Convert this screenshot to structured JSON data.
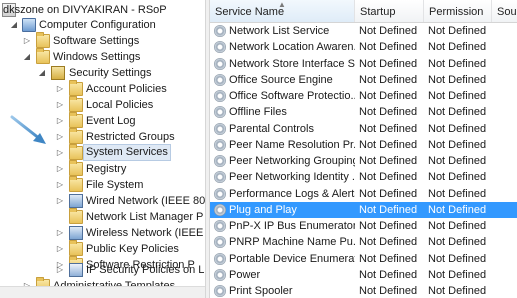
{
  "tree": {
    "items": [
      {
        "label": "dkszone on DIVYAKIRAN - RSoP",
        "icon": "rsop-icon",
        "expander": ""
      },
      {
        "label": "Computer Configuration",
        "icon": "computer-icon",
        "expander": "◢"
      },
      {
        "label": "Software Settings",
        "icon": "folder-icon",
        "expander": "▷"
      },
      {
        "label": "Windows Settings",
        "icon": "folder-icon",
        "expander": "◢"
      },
      {
        "label": "Security Settings",
        "icon": "security-settings-icon",
        "expander": "◢"
      },
      {
        "label": "Account Policies",
        "icon": "folder-icon",
        "expander": "▷"
      },
      {
        "label": "Local Policies",
        "icon": "folder-icon",
        "expander": "▷"
      },
      {
        "label": "Event Log",
        "icon": "folder-icon",
        "expander": "▷"
      },
      {
        "label": "Restricted Groups",
        "icon": "folder-icon",
        "expander": "▷"
      },
      {
        "label": "System Services",
        "icon": "folder-icon",
        "expander": "▷"
      },
      {
        "label": "Registry",
        "icon": "folder-icon",
        "expander": "▷"
      },
      {
        "label": "File System",
        "icon": "folder-icon",
        "expander": "▷"
      },
      {
        "label": "Wired Network (IEEE 80",
        "icon": "network-icon",
        "expander": "▷"
      },
      {
        "label": "Network List Manager P",
        "icon": "folder-icon",
        "expander": ""
      },
      {
        "label": "Wireless Network (IEEE",
        "icon": "network-icon",
        "expander": "▷"
      },
      {
        "label": "Public Key Policies",
        "icon": "folder-icon",
        "expander": "▷"
      },
      {
        "label": "Software Restriction P",
        "icon": "folder-icon",
        "expander": "▷"
      },
      {
        "label": "IP Security Policies on L",
        "icon": "ip-security-icon",
        "expander": "▷"
      },
      {
        "label": "Administrative Templates",
        "icon": "folder-icon",
        "expander": "▷"
      }
    ]
  },
  "list": {
    "columns": [
      "Service Name",
      "Startup",
      "Permission",
      "Sour"
    ],
    "rows": [
      {
        "name": "Network List Service",
        "startup": "Not Defined",
        "permission": "Not Defined"
      },
      {
        "name": "Network Location Awaren...",
        "startup": "Not Defined",
        "permission": "Not Defined"
      },
      {
        "name": "Network Store Interface S...",
        "startup": "Not Defined",
        "permission": "Not Defined"
      },
      {
        "name": "Office  Source Engine",
        "startup": "Not Defined",
        "permission": "Not Defined"
      },
      {
        "name": "Office Software Protectio...",
        "startup": "Not Defined",
        "permission": "Not Defined"
      },
      {
        "name": "Offline Files",
        "startup": "Not Defined",
        "permission": "Not Defined"
      },
      {
        "name": "Parental Controls",
        "startup": "Not Defined",
        "permission": "Not Defined"
      },
      {
        "name": "Peer Name Resolution Pr...",
        "startup": "Not Defined",
        "permission": "Not Defined"
      },
      {
        "name": "Peer Networking Grouping",
        "startup": "Not Defined",
        "permission": "Not Defined"
      },
      {
        "name": "Peer Networking Identity ...",
        "startup": "Not Defined",
        "permission": "Not Defined"
      },
      {
        "name": "Performance Logs & Alerts",
        "startup": "Not Defined",
        "permission": "Not Defined"
      },
      {
        "name": "Plug and Play",
        "startup": "Not Defined",
        "permission": "Not Defined"
      },
      {
        "name": "PnP-X IP Bus Enumerator",
        "startup": "Not Defined",
        "permission": "Not Defined"
      },
      {
        "name": "PNRP Machine Name Pu...",
        "startup": "Not Defined",
        "permission": "Not Defined"
      },
      {
        "name": "Portable Device Enumerat...",
        "startup": "Not Defined",
        "permission": "Not Defined"
      },
      {
        "name": "Power",
        "startup": "Not Defined",
        "permission": "Not Defined"
      },
      {
        "name": "Print Spooler",
        "startup": "Not Defined",
        "permission": "Not Defined"
      }
    ]
  },
  "colors": {
    "selection": "#3399ff",
    "tree_highlight": "#dfe9f5",
    "annotation_arrow": "#4a90c8"
  }
}
